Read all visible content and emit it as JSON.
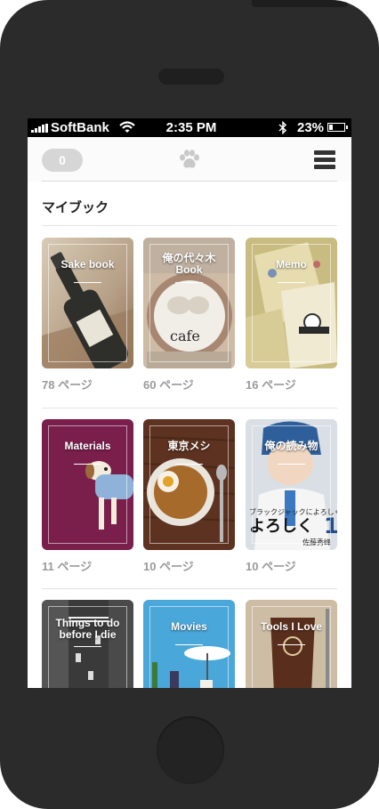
{
  "status": {
    "carrier": "SoftBank",
    "time": "2:35 PM",
    "battery": "23%",
    "bluetooth_icon": "bluetooth-icon",
    "wifi_icon": "wifi-icon"
  },
  "topbar": {
    "counter": "0",
    "center_icon": "paw-icon",
    "menu_icon": "hamburger-menu-icon"
  },
  "section": {
    "title": "マイブック"
  },
  "books": [
    {
      "title": "Sake book",
      "pages": "78 ページ",
      "color": "#b9a58c"
    },
    {
      "title": "俺の代々木\nBook",
      "pages": "60 ページ",
      "color": "#c9b59f"
    },
    {
      "title": "Memo",
      "pages": "16 ページ",
      "color": "#cbbd7a"
    },
    {
      "title": "Materials",
      "pages": "11 ページ",
      "color": "#7a1e4c"
    },
    {
      "title": "東京メシ",
      "pages": "10 ページ",
      "color": "#6b3a24"
    },
    {
      "title": "俺の読み物",
      "pages": "10 ページ",
      "color": "#cfd6dc",
      "cover_text": "ブラックジャックによろしく",
      "cover_text_big": "よろしく",
      "cover_number": "1",
      "cover_author": "佐藤秀峰"
    },
    {
      "title": "Things to do\nbefore I die",
      "color": "#3d3d3d"
    },
    {
      "title": "Movies",
      "color": "#3aa5d8"
    },
    {
      "title": "Tools I Love",
      "color": "#c8b8a0"
    }
  ]
}
